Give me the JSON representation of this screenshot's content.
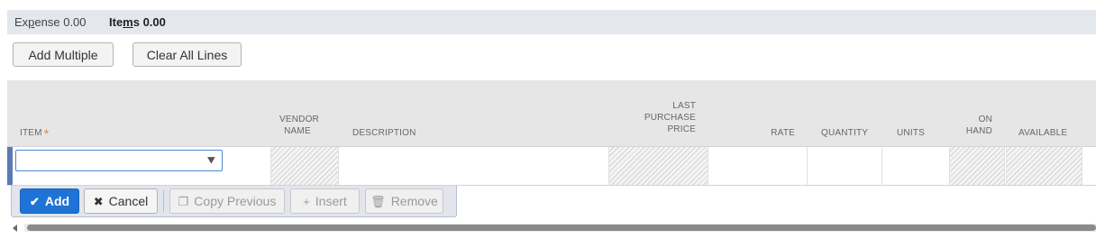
{
  "tabs": [
    {
      "label": "Expense 0.00",
      "pre": "Ex",
      "ul": "p",
      "post": "ense 0.00"
    },
    {
      "label": "Items 0.00",
      "pre": "Ite",
      "ul": "m",
      "post": "s 0.00",
      "active": true
    }
  ],
  "toolbar": {
    "add_multiple": "Add Multiple",
    "clear_all": "Clear All Lines"
  },
  "columns": {
    "item": "ITEM",
    "vendor_name_1": "VENDOR",
    "vendor_name_2": "NAME",
    "description": "DESCRIPTION",
    "last_purchase_1": "LAST",
    "last_purchase_2": "PURCHASE",
    "last_purchase_3": "PRICE",
    "rate": "RATE",
    "quantity": "QUANTITY",
    "units": "UNITS",
    "on_hand_1": "ON",
    "on_hand_2": "HAND",
    "available": "AVAILABLE",
    "required_mark": "*"
  },
  "row": {
    "item_value": "",
    "dropdown_icon": "double-chevron-down-icon"
  },
  "row_actions": {
    "add": "Add",
    "cancel": "Cancel",
    "copy_previous": "Copy Previous",
    "insert": "Insert",
    "remove": "Remove"
  },
  "colors": {
    "primary": "#1e73d6",
    "required": "#e08a2e",
    "tab_bg": "#e5e7ee"
  }
}
